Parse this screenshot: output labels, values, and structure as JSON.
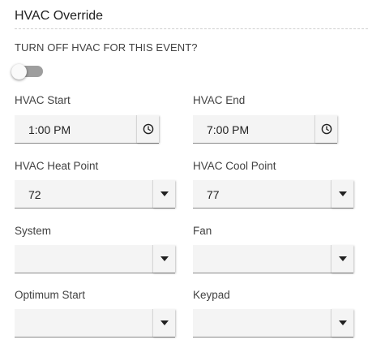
{
  "section": {
    "title": "HVAC Override",
    "question": "TURN OFF HVAC FOR THIS EVENT?",
    "toggle_on": false
  },
  "fields": {
    "hvac_start": {
      "label": "HVAC Start",
      "value": "1:00 PM",
      "icon": "clock-icon"
    },
    "hvac_end": {
      "label": "HVAC End",
      "value": "7:00 PM",
      "icon": "clock-icon"
    },
    "heat_point": {
      "label": "HVAC Heat Point",
      "value": "72",
      "icon": "caret-down-icon"
    },
    "cool_point": {
      "label": "HVAC Cool Point",
      "value": "77",
      "icon": "caret-down-icon"
    },
    "system": {
      "label": "System",
      "value": "",
      "icon": "caret-down-icon"
    },
    "fan": {
      "label": "Fan",
      "value": "",
      "icon": "caret-down-icon"
    },
    "optimum_start": {
      "label": "Optimum Start",
      "value": "",
      "icon": "caret-down-icon"
    },
    "keypad": {
      "label": "Keypad",
      "value": "",
      "icon": "caret-down-icon"
    }
  }
}
